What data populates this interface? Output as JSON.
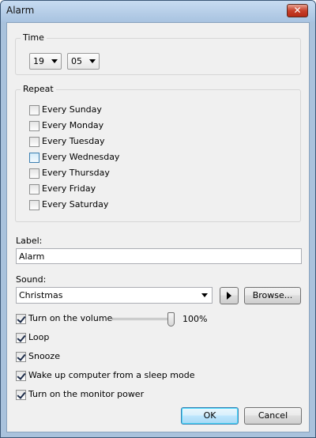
{
  "window": {
    "title": "Alarm",
    "close_label": "✕"
  },
  "time": {
    "group_label": "Time",
    "hour": "19",
    "minute": "05"
  },
  "repeat": {
    "group_label": "Repeat",
    "days": [
      {
        "label": "Every Sunday",
        "checked": false
      },
      {
        "label": "Every Monday",
        "checked": false
      },
      {
        "label": "Every Tuesday",
        "checked": false
      },
      {
        "label": "Every Wednesday",
        "checked": false
      },
      {
        "label": "Every Thursday",
        "checked": false
      },
      {
        "label": "Every Friday",
        "checked": false
      },
      {
        "label": "Every Saturday",
        "checked": false
      }
    ]
  },
  "label_field": {
    "label": "Label:",
    "value": "Alarm"
  },
  "sound": {
    "label": "Sound:",
    "value": "Christmas",
    "browse_label": "Browse..."
  },
  "options": {
    "volume": {
      "label": "Turn on the volume",
      "checked": true,
      "level_text": "100%",
      "level": 1.0
    },
    "loop": {
      "label": "Loop",
      "checked": true
    },
    "snooze": {
      "label": "Snooze",
      "checked": true
    },
    "wake": {
      "label": "Wake up computer from a sleep mode",
      "checked": true
    },
    "monitor": {
      "label": "Turn on the monitor power",
      "checked": true
    }
  },
  "buttons": {
    "ok": "OK",
    "cancel": "Cancel"
  }
}
